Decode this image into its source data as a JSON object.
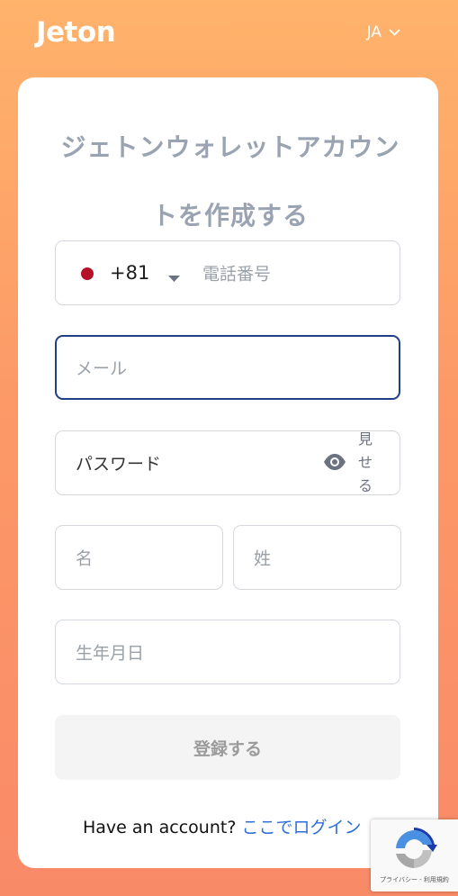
{
  "header": {
    "logo": "Jeton",
    "language": "JA"
  },
  "form": {
    "title": "ジェトンウォレットアカウントを作成する",
    "phone": {
      "country_code": "+81",
      "flag": "japan-flag",
      "placeholder": "電話番号"
    },
    "email_placeholder": "メール",
    "password": {
      "placeholder": "パスワード",
      "show_label": "見せる"
    },
    "first_name_placeholder": "名",
    "last_name_placeholder": "姓",
    "birthdate_placeholder": "生年月日",
    "submit_label": "登録する",
    "login_prompt": "Have an account?",
    "login_link": "ここでログイン"
  },
  "recaptcha": {
    "footer_text": "プライバシー - 利用規約"
  },
  "colors": {
    "background_top": "#ffb36b",
    "background_bottom": "#f98a68",
    "title": "#9aa3b1",
    "focus_border": "#1f3f87",
    "link": "#2f6fd8",
    "flag_red": "#b5122a"
  }
}
